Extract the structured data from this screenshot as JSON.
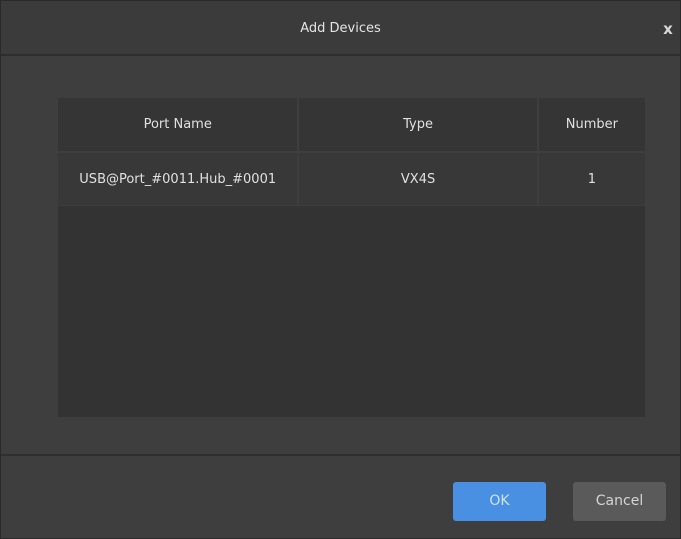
{
  "dialog": {
    "title": "Add Devices",
    "close_label": "x"
  },
  "table": {
    "columns": [
      "Port Name",
      "Type",
      "Number"
    ],
    "rows": [
      {
        "port_name": "USB@Port_#0011.Hub_#0001",
        "type": "VX4S",
        "number": "1"
      }
    ]
  },
  "buttons": {
    "ok_label": "OK",
    "cancel_label": "Cancel"
  },
  "colors": {
    "accent": "#4a90e2",
    "background": "#3e3e3e",
    "table_bg": "#333333"
  }
}
